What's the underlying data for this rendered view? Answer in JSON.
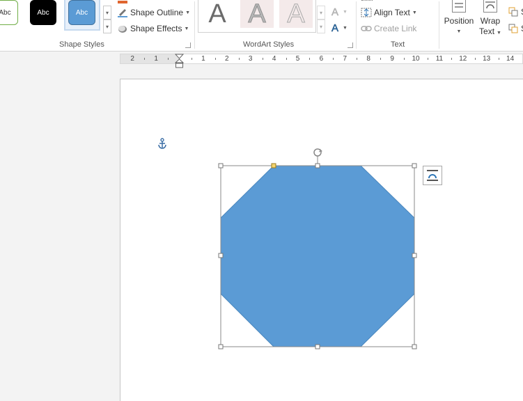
{
  "ribbon": {
    "shape_styles": {
      "label": "Shape Styles",
      "swatches": [
        {
          "text": "Abc",
          "style": "outline-green"
        },
        {
          "text": "Abc",
          "style": "black"
        },
        {
          "text": "Abc",
          "style": "blue-selected"
        }
      ],
      "shape_fill": "",
      "shape_outline": "Shape Outline",
      "shape_effects": "Shape Effects"
    },
    "wordart_styles": {
      "label": "WordArt Styles",
      "tiles": [
        "A",
        "A",
        "A"
      ],
      "text_fill_icon": "A",
      "text_effects_icon": "A"
    },
    "text": {
      "label": "Text",
      "align_text": "Align Text",
      "create_link": "Create Link"
    },
    "arrange": {
      "position": "Position",
      "wrap_text_line1": "Wrap",
      "wrap_text_line2": "Text",
      "partial_1": "S",
      "partial_2": "S"
    }
  },
  "ruler": {
    "labels": [
      "2",
      "1",
      "1",
      "2",
      "3",
      "4",
      "5",
      "6",
      "7",
      "8",
      "9",
      "10",
      "11",
      "12",
      "13",
      "14"
    ]
  },
  "colors": {
    "shape_fill": "#5b9bd5",
    "shape_edge": "#4a87be",
    "accent_outline": "#5b9bd5",
    "handle_yellow": "#f5d56f",
    "swatch_green": "#70ad47"
  },
  "document": {
    "shape_type": "octagon",
    "wrap_icon": "layout-options-icon"
  }
}
